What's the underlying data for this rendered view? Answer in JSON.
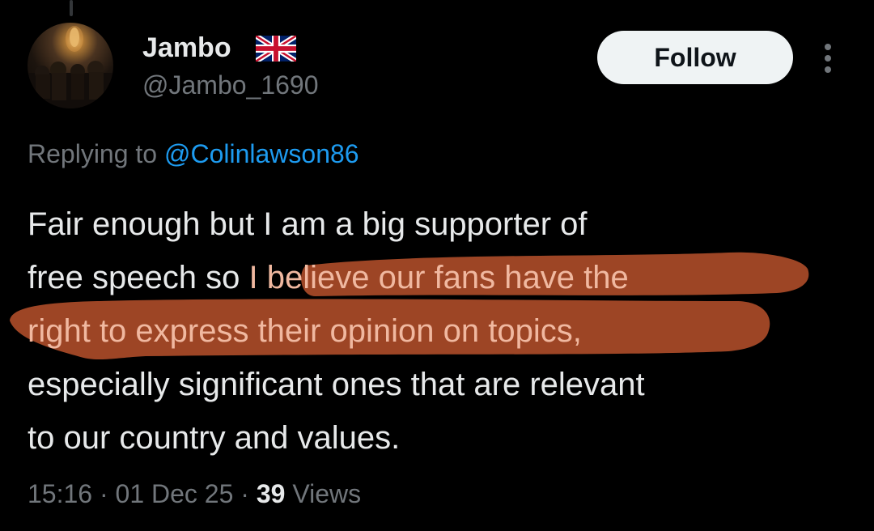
{
  "author": {
    "display_name": "Jambo",
    "handle": "@Jambo_1690",
    "flag": "uk-flag-icon",
    "avatar": "profile-photo"
  },
  "actions": {
    "follow_label": "Follow",
    "more": "more-options-icon"
  },
  "reply": {
    "prefix": "Replying to ",
    "mention": "@Colinlawson86"
  },
  "tweet": {
    "line1": "Fair enough but I am a big supporter of",
    "line2_plain": "free speech so ",
    "line2_highlighted": "I believe our fans have the",
    "line3_highlighted": "right to express their opinion on topics,",
    "line4": "especially significant ones that are relevant",
    "line5": "to our country and values."
  },
  "meta": {
    "time": "15:16",
    "sep1": " · ",
    "date": "01 Dec 25",
    "sep2": " · ",
    "views_count": "39",
    "views_label": " Views"
  },
  "colors": {
    "background": "#000000",
    "text": "#e7e9ea",
    "secondary": "#71767b",
    "link": "#1d9bf0",
    "highlight": "#b34f2a"
  }
}
